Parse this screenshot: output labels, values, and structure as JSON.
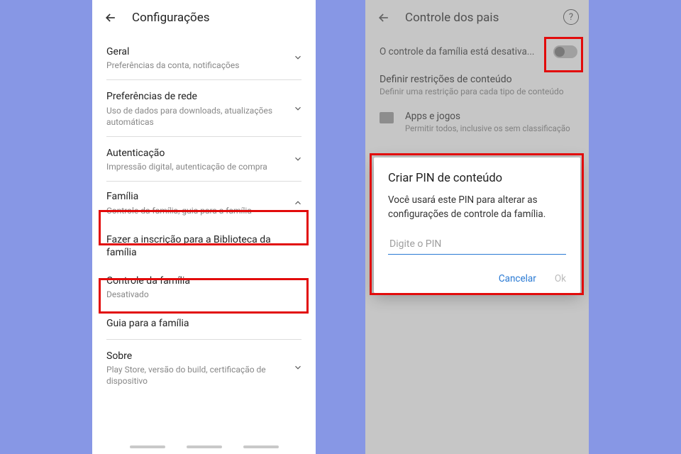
{
  "left": {
    "title": "Configurações",
    "rows": {
      "general": {
        "label": "Geral",
        "sub": "Preferências da conta, notificações"
      },
      "network": {
        "label": "Preferências de rede",
        "sub": "Uso de dados para downloads, atualizações automáticas"
      },
      "auth": {
        "label": "Autenticação",
        "sub": "Impressão digital, autenticação de compra"
      },
      "family": {
        "label": "Família",
        "sub": "Controle da família, guia para a família"
      },
      "signup": {
        "label": "Fazer a inscrição para a Biblioteca da família"
      },
      "control": {
        "label": "Controle da família",
        "sub": "Desativado"
      },
      "guide": {
        "label": "Guia para a família"
      },
      "about": {
        "label": "Sobre",
        "sub": "Play Store, versão do build, certificação de dispositivo"
      }
    }
  },
  "right": {
    "title": "Controle dos pais",
    "status_text": "O controle da família está desativa...",
    "section": {
      "title": "Definir restrições de conteúdo",
      "sub": "Definir uma restrição para cada tipo de conteúdo"
    },
    "apps": {
      "title": "Apps e jogos",
      "sub": "Permitir todos, inclusive os sem classificação"
    },
    "dialog": {
      "title": "Criar PIN de conteúdo",
      "desc": "Você usará este PIN para alterar as configurações de controle da família.",
      "placeholder": "Digite o PIN",
      "cancel": "Cancelar",
      "ok": "Ok"
    }
  }
}
